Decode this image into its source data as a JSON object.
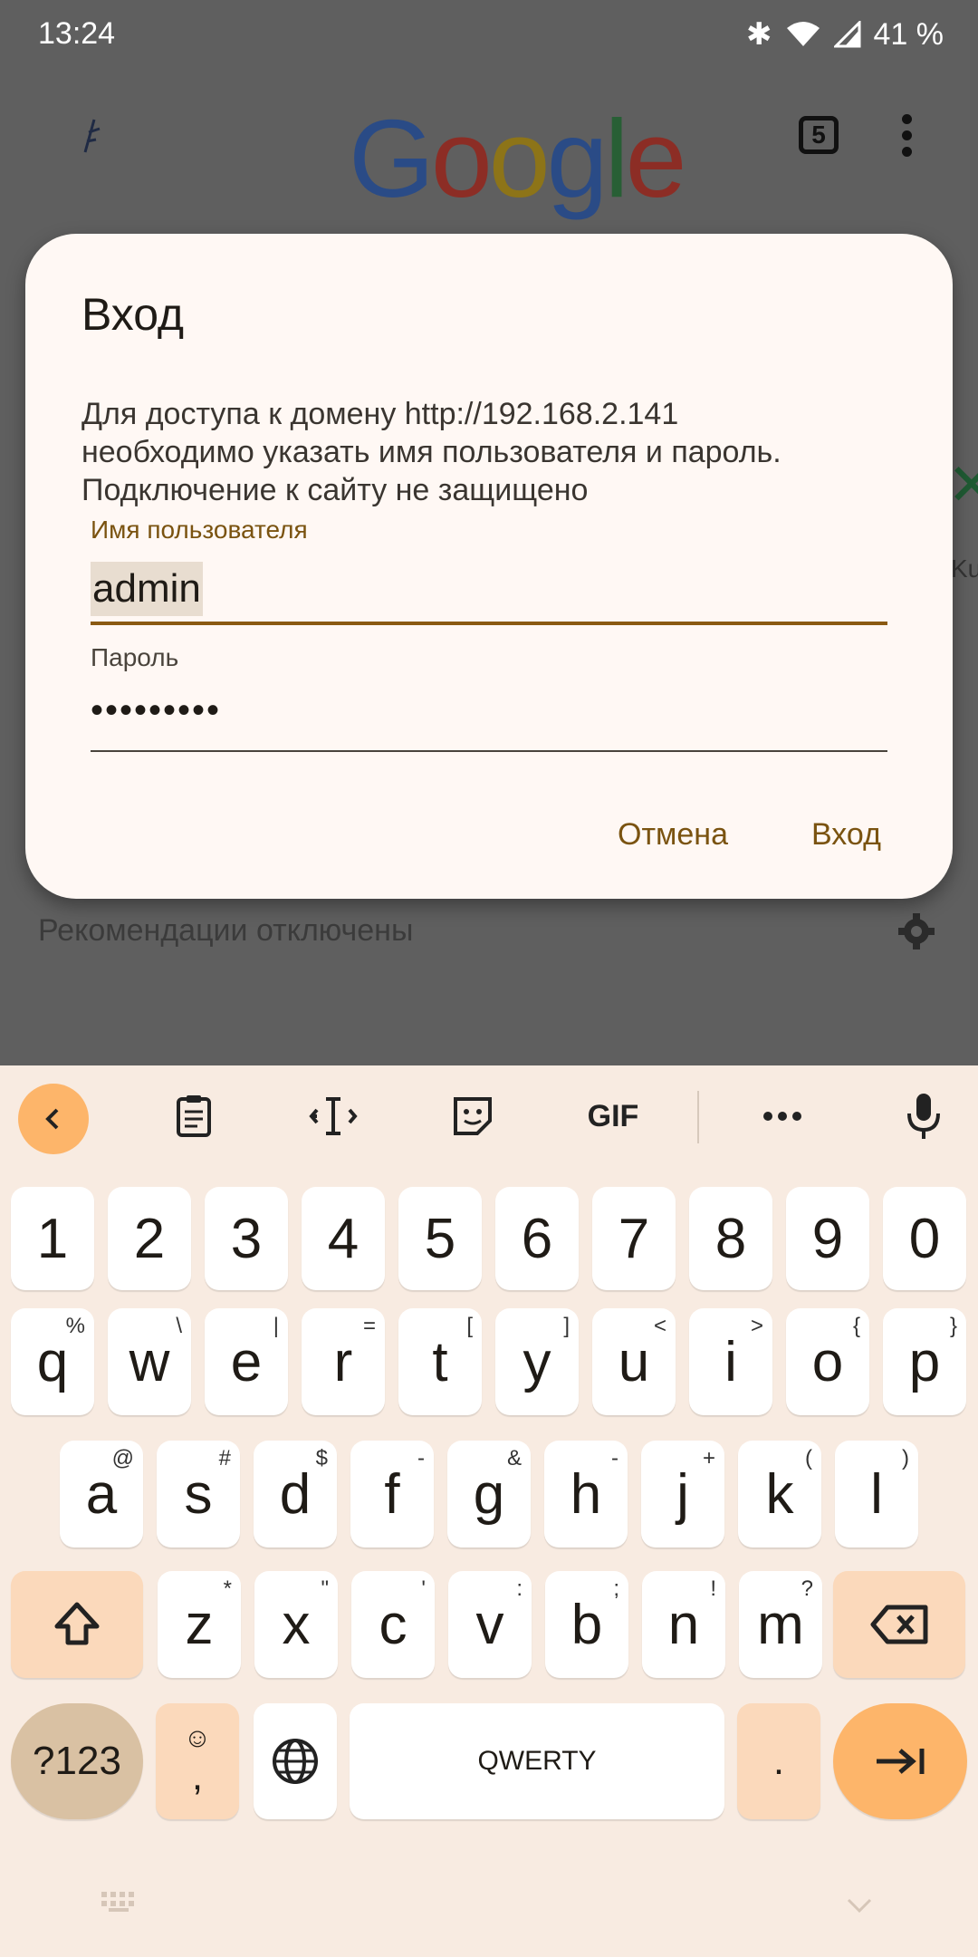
{
  "status_bar": {
    "time": "13:24",
    "battery": "41 %"
  },
  "browser": {
    "logo": [
      "G",
      "o",
      "o",
      "g",
      "l",
      "e"
    ],
    "tab_count": "5",
    "recommendations_text": "Рекомендации отключены",
    "side_partial_text": "Ku"
  },
  "dialog": {
    "title": "Вход",
    "message_line1": "Для доступа к домену http://192.168.2.141",
    "message_line2": "необходимо указать имя пользователя и пароль.",
    "message_line3": "Подключение к сайту не защищено",
    "username_label": "Имя пользователя",
    "username_value": "admin",
    "password_label": "Пароль",
    "password_value": "•••••••••",
    "cancel_label": "Отмена",
    "login_label": "Вход"
  },
  "keyboard": {
    "toolbar": {
      "gif_label": "GIF"
    },
    "row_numbers": [
      "1",
      "2",
      "3",
      "4",
      "5",
      "6",
      "7",
      "8",
      "9",
      "0"
    ],
    "row_q": [
      {
        "k": "q",
        "s": "%"
      },
      {
        "k": "w",
        "s": "\\"
      },
      {
        "k": "e",
        "s": "|"
      },
      {
        "k": "r",
        "s": "="
      },
      {
        "k": "t",
        "s": "["
      },
      {
        "k": "y",
        "s": "]"
      },
      {
        "k": "u",
        "s": "<"
      },
      {
        "k": "i",
        "s": ">"
      },
      {
        "k": "o",
        "s": "{"
      },
      {
        "k": "p",
        "s": "}"
      }
    ],
    "row_a": [
      {
        "k": "a",
        "s": "@"
      },
      {
        "k": "s",
        "s": "#"
      },
      {
        "k": "d",
        "s": "$"
      },
      {
        "k": "f",
        "s": "-"
      },
      {
        "k": "g",
        "s": "&"
      },
      {
        "k": "h",
        "s": "-"
      },
      {
        "k": "j",
        "s": "+"
      },
      {
        "k": "k",
        "s": "("
      },
      {
        "k": "l",
        "s": ")"
      }
    ],
    "row_z": [
      {
        "k": "z",
        "s": "*"
      },
      {
        "k": "x",
        "s": "\""
      },
      {
        "k": "c",
        "s": "'"
      },
      {
        "k": "v",
        "s": ":"
      },
      {
        "k": "b",
        "s": ";"
      },
      {
        "k": "n",
        "s": "!"
      },
      {
        "k": "m",
        "s": "?"
      }
    ],
    "symbols_label": "?123",
    "comma_label": ",",
    "space_label": "QWERTY",
    "period_label": "."
  },
  "colors": {
    "accent": "#7a5310",
    "keyboard_accent": "#fdb56a"
  }
}
